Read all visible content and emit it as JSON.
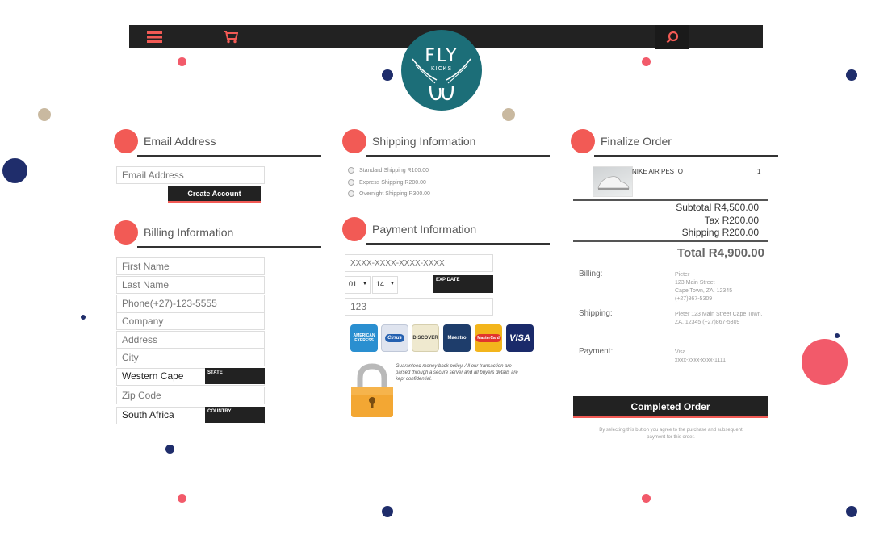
{
  "brand": {
    "logo_main": "FLY",
    "logo_sub": "KICKS"
  },
  "icons": {
    "menu": "menu-icon",
    "cart": "cart-icon",
    "search": "search-icon"
  },
  "colors": {
    "accent": "#f25a55",
    "dark": "#222222",
    "teal": "#1c6e78",
    "navy": "#1f2d6b"
  },
  "email_section": {
    "title": "Email Address",
    "email_placeholder": "Email Address",
    "create_button": "Create Account"
  },
  "billing_section": {
    "title": "Billing Information",
    "first_name_placeholder": "First Name",
    "last_name_placeholder": "Last Name",
    "phone_placeholder": "Phone(+27)-123-5555",
    "company_placeholder": "Company",
    "address_placeholder": "Address",
    "city_placeholder": "City",
    "state_value": "Western Cape",
    "state_tag": "STATE",
    "zip_placeholder": "Zip Code",
    "country_value": "South Africa",
    "country_tag": "COUNTRY"
  },
  "shipping_section": {
    "title": "Shipping Information",
    "options": [
      "Standard Shipping R100.00",
      "Express Shipping R200.00",
      "Overnight Shipping R300.00"
    ]
  },
  "payment_section": {
    "title": "Payment Information",
    "card_placeholder": "XXXX-XXXX-XXXX-XXXX",
    "month_value": "01",
    "year_value": "14",
    "exp_tag": "EXP DATE",
    "cvv_placeholder": "123",
    "cards": [
      "AMERICAN EXPRESS",
      "Cirrus",
      "DISCOVER",
      "Maestro",
      "MasterCard",
      "VISA"
    ],
    "guarantee": "Guaranteed money back policy. All our transaction are parsed through a secure server and all buyers details are kept confidential."
  },
  "order_section": {
    "title": "Finalize Order",
    "item_name": "NIKE AIR PESTO",
    "item_qty": "1",
    "subtotal": "Subtotal R4,500.00",
    "tax": "Tax R200.00",
    "shipping": "Shipping R200.00",
    "total": "Total R4,900.00",
    "billing_label": "Billing:",
    "billing_value": "Pieter\n123 Main Street\nCape Town, ZA, 12345\n(+27)867-5309",
    "shipping_label": "Shipping:",
    "shipping_value": "Pieter 123 Main Street Cape Town,\nZA, 12345 (+27)867-5309",
    "payment_label": "Payment:",
    "payment_value": "Visa\nxxxx-xxxx-xxxx-1111",
    "complete_button": "Completed Order",
    "terms": "By selecting this button you agree to the purchase and subsequent payment for this order."
  }
}
